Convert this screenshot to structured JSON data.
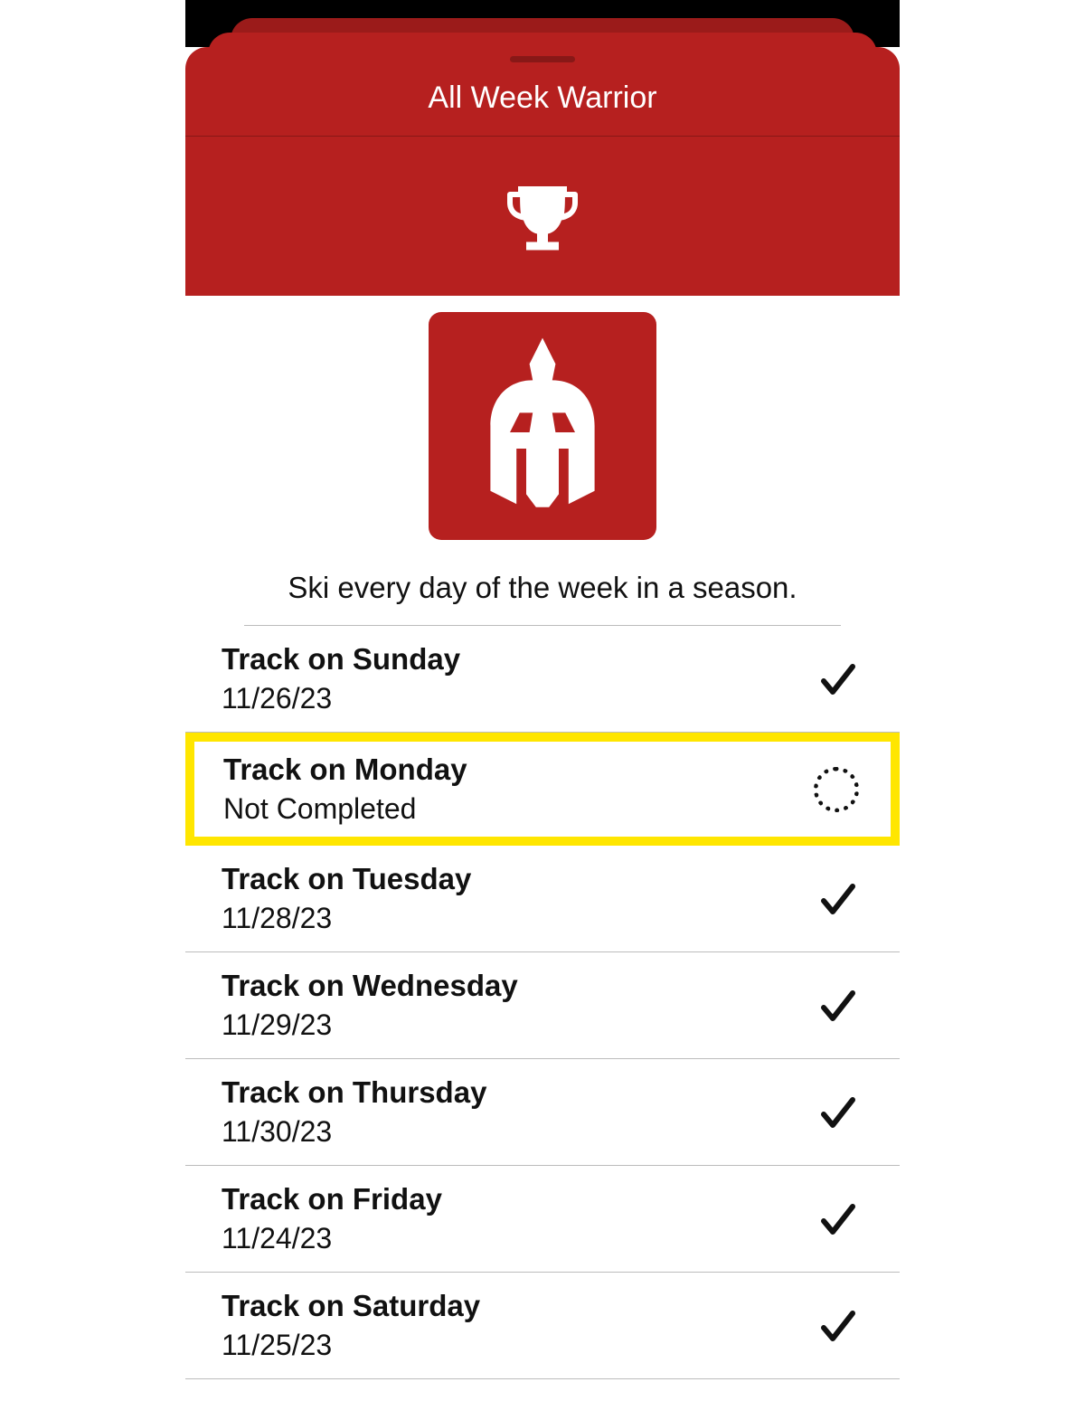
{
  "header": {
    "title": "All Week Warrior"
  },
  "description": "Ski every day of the week in a season.",
  "rows": [
    {
      "title": "Track on Sunday",
      "sub": "11/26/23",
      "completed": true,
      "highlight": false
    },
    {
      "title": "Track on Monday",
      "sub": "Not Completed",
      "completed": false,
      "highlight": true
    },
    {
      "title": "Track on Tuesday",
      "sub": "11/28/23",
      "completed": true,
      "highlight": false
    },
    {
      "title": "Track on Wednesday",
      "sub": "11/29/23",
      "completed": true,
      "highlight": false
    },
    {
      "title": "Track on Thursday",
      "sub": "11/30/23",
      "completed": true,
      "highlight": false
    },
    {
      "title": "Track on Friday",
      "sub": "11/24/23",
      "completed": true,
      "highlight": false
    },
    {
      "title": "Track on Saturday",
      "sub": "11/25/23",
      "completed": true,
      "highlight": false
    }
  ],
  "colors": {
    "brand": "#b6201f",
    "highlight": "#ffe600"
  }
}
